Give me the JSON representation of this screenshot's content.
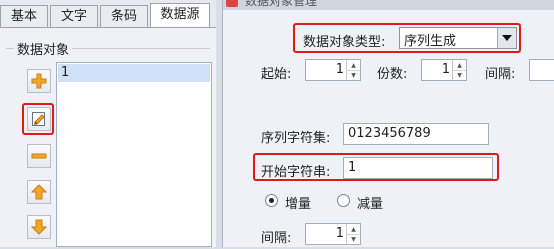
{
  "tabs": [
    {
      "label": "基本"
    },
    {
      "label": "文字"
    },
    {
      "label": "条码"
    },
    {
      "label": "数据源",
      "active": true
    }
  ],
  "data_object_group": {
    "title": "数据对象",
    "items": [
      "1"
    ]
  },
  "toolbar_icons": [
    "add-icon",
    "edit-icon",
    "remove-icon",
    "move-up-icon",
    "move-down-icon"
  ],
  "dialog": {
    "title": "数据对象管理",
    "type_label": "数据对象类型:",
    "type_value": "序列生成",
    "start_label": "起始:",
    "start_value": "1",
    "count_label": "份数:",
    "count_value": "1",
    "interval_label": "间隔:",
    "charset_label": "序列字符集:",
    "charset_value": "0123456789",
    "start_string_label": "开始字符串:",
    "start_string_value": "1",
    "increment_label": "增量",
    "decrement_label": "减量",
    "step_label": "间隔:",
    "step_value": "1"
  },
  "colors": {
    "highlight": "#e01919",
    "selection": "#cfe0f7",
    "icon_orange": "#f5a623"
  }
}
